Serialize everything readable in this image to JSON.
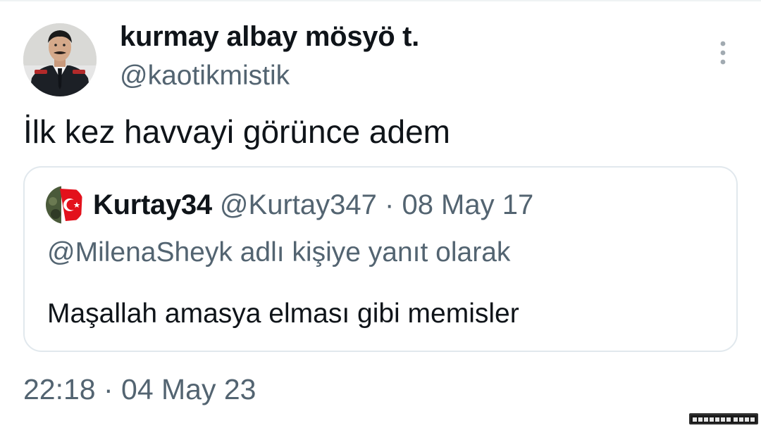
{
  "author": {
    "display_name": "kurmay albay mösyö t.",
    "handle": "@kaotikmistik",
    "avatar_icon": "profile-photo-officer"
  },
  "tweet": {
    "text": "İlk kez havvayi görünce adem",
    "timestamp": "22:18 · 04 May 23"
  },
  "quote": {
    "display_name": "Kurtay34",
    "handle": "@Kurtay347",
    "separator": "·",
    "date": "08 May 17",
    "reply_mention": "@MilenaSheyk",
    "reply_suffix": "adlı kişiye yanıt olarak",
    "text": "Maşallah amasya elması gibi memisler",
    "avatar_icon": "profile-photo-flag"
  },
  "menu": {
    "icon": "more-vertical-icon"
  },
  "watermark": {
    "text": "GULDUM.NET"
  },
  "colors": {
    "text_primary": "#0f1419",
    "text_secondary": "#536471",
    "border": "#e1e8ed",
    "background": "#ffffff"
  }
}
